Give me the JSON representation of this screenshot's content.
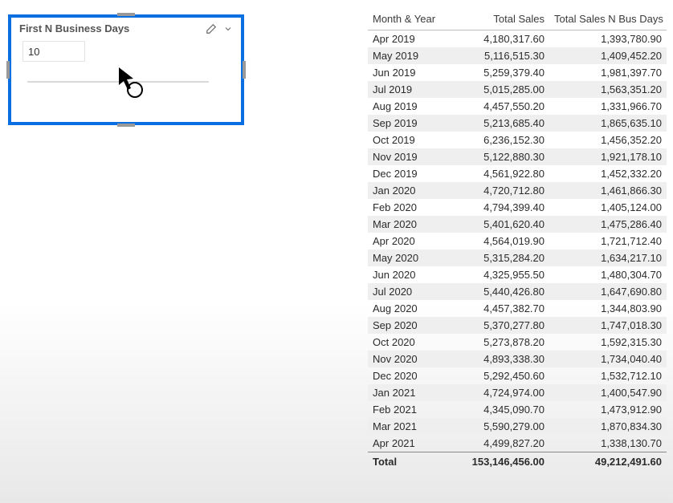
{
  "slicer": {
    "title": "First N Business Days",
    "value": "10"
  },
  "table": {
    "headers": {
      "month": "Month & Year",
      "sales": "Total Sales",
      "bus": "Total Sales N Bus Days"
    },
    "rows": [
      {
        "month": "Apr 2019",
        "sales": "4,180,317.60",
        "bus": "1,393,780.90"
      },
      {
        "month": "May 2019",
        "sales": "5,116,515.30",
        "bus": "1,409,452.20"
      },
      {
        "month": "Jun 2019",
        "sales": "5,259,379.40",
        "bus": "1,981,397.70"
      },
      {
        "month": "Jul 2019",
        "sales": "5,015,285.00",
        "bus": "1,563,351.20"
      },
      {
        "month": "Aug 2019",
        "sales": "4,457,550.20",
        "bus": "1,331,966.70"
      },
      {
        "month": "Sep 2019",
        "sales": "5,213,685.40",
        "bus": "1,865,635.10"
      },
      {
        "month": "Oct 2019",
        "sales": "6,236,152.30",
        "bus": "1,456,352.20"
      },
      {
        "month": "Nov 2019",
        "sales": "5,122,880.30",
        "bus": "1,921,178.10"
      },
      {
        "month": "Dec 2019",
        "sales": "4,561,922.80",
        "bus": "1,452,332.20"
      },
      {
        "month": "Jan 2020",
        "sales": "4,720,712.80",
        "bus": "1,461,866.30"
      },
      {
        "month": "Feb 2020",
        "sales": "4,794,399.40",
        "bus": "1,405,124.00"
      },
      {
        "month": "Mar 2020",
        "sales": "5,401,620.40",
        "bus": "1,475,286.40"
      },
      {
        "month": "Apr 2020",
        "sales": "4,564,019.90",
        "bus": "1,721,712.40"
      },
      {
        "month": "May 2020",
        "sales": "5,315,284.20",
        "bus": "1,634,217.10"
      },
      {
        "month": "Jun 2020",
        "sales": "4,325,955.50",
        "bus": "1,480,304.70"
      },
      {
        "month": "Jul 2020",
        "sales": "5,440,426.80",
        "bus": "1,647,690.80"
      },
      {
        "month": "Aug 2020",
        "sales": "4,457,382.70",
        "bus": "1,344,803.90"
      },
      {
        "month": "Sep 2020",
        "sales": "5,370,277.80",
        "bus": "1,747,018.30"
      },
      {
        "month": "Oct 2020",
        "sales": "5,273,878.20",
        "bus": "1,592,315.30"
      },
      {
        "month": "Nov 2020",
        "sales": "4,893,338.30",
        "bus": "1,734,040.40"
      },
      {
        "month": "Dec 2020",
        "sales": "5,292,450.60",
        "bus": "1,532,712.10"
      },
      {
        "month": "Jan 2021",
        "sales": "4,724,974.00",
        "bus": "1,400,547.90"
      },
      {
        "month": "Feb 2021",
        "sales": "4,345,090.70",
        "bus": "1,473,912.90"
      },
      {
        "month": "Mar 2021",
        "sales": "5,590,279.00",
        "bus": "1,870,834.30"
      },
      {
        "month": "Apr 2021",
        "sales": "4,499,827.20",
        "bus": "1,338,130.70"
      }
    ],
    "footer": {
      "label": "Total",
      "sales": "153,146,456.00",
      "bus": "49,212,491.60"
    }
  }
}
